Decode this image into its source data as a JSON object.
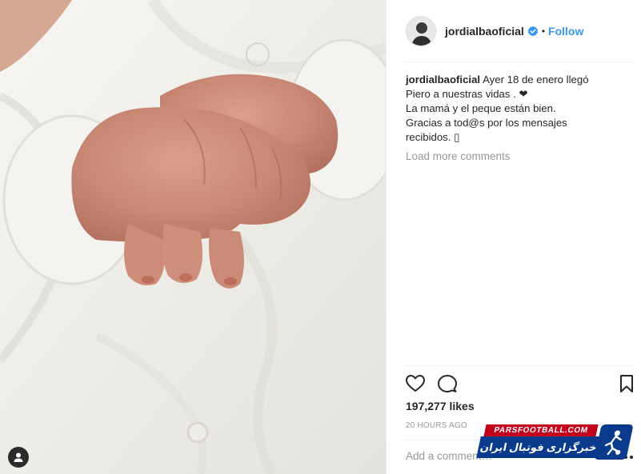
{
  "post": {
    "username": "jordialbaoficial",
    "separator": "•",
    "follow_label": "Follow",
    "caption_lines": [
      "Ayer 18 de enero llegó",
      "Piero a nuestras vidas . ❤",
      "La mamá y el peque están bien.",
      "Gracias a tod@s por los mensajes",
      "recibidos. ▯"
    ],
    "load_more_label": "Load more comments",
    "likes": "197,277 likes",
    "timestamp": "20 HOURS AGO",
    "add_comment_placeholder": "Add a comment…"
  },
  "watermark": {
    "site": "PARSFOOTBALL.COM",
    "tagline": "خبرگزاری فوتبال ایران"
  },
  "colors": {
    "link_blue": "#3897f0",
    "muted_gray": "#999999",
    "text": "#262626",
    "divider": "#efefef",
    "watermark_red": "#c2001c",
    "watermark_blue": "#0a3a8c"
  },
  "icons": {
    "verified": "verified-badge-icon",
    "like": "heart-icon",
    "comment": "comment-bubble-icon",
    "save": "bookmark-icon",
    "more": "ellipsis-icon",
    "tagged": "user-tag-icon"
  }
}
